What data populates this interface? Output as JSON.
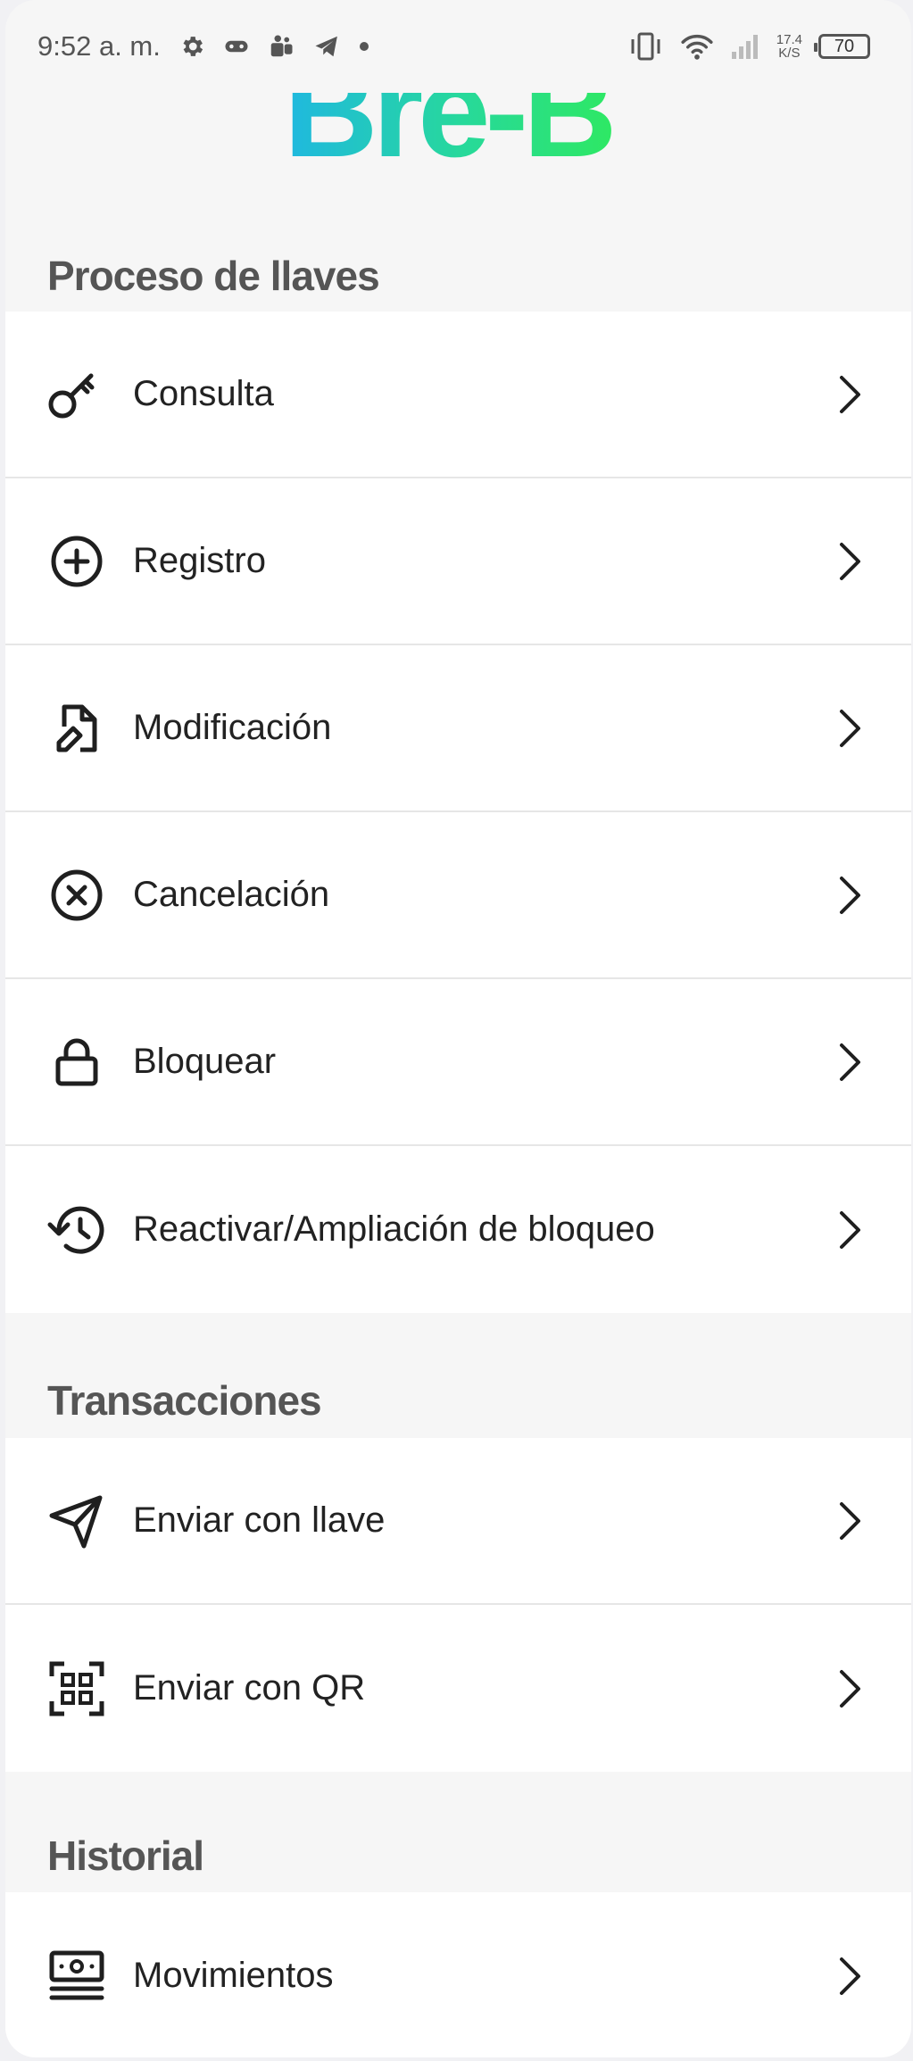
{
  "status_bar": {
    "time": "9:52 a. m.",
    "net_speed_value": "17.4",
    "net_speed_unit": "K/S",
    "battery": "70",
    "left_icons": [
      "gear-icon",
      "gamepad-icon",
      "teams-icon",
      "telegram-icon",
      "dot-icon"
    ],
    "right_icons": [
      "vibrate-icon",
      "wifi-icon",
      "signal-icon",
      "battery-icon"
    ]
  },
  "brand": {
    "logo_text": "Bre-B",
    "gradient": [
      "#1fb8e0",
      "#2ee864"
    ]
  },
  "sections": {
    "keys": {
      "title": "Proceso de llaves",
      "items": [
        {
          "label": "Consulta",
          "icon": "key-icon"
        },
        {
          "label": "Registro",
          "icon": "add-circle-icon"
        },
        {
          "label": "Modificación",
          "icon": "edit-document-icon"
        },
        {
          "label": "Cancelación",
          "icon": "cancel-circle-icon"
        },
        {
          "label": "Bloquear",
          "icon": "lock-icon"
        },
        {
          "label": "Reactivar/Ampliación de bloqueo",
          "icon": "history-icon"
        }
      ]
    },
    "transactions": {
      "title": "Transacciones",
      "items": [
        {
          "label": "Enviar con llave",
          "icon": "send-icon"
        },
        {
          "label": "Enviar con QR",
          "icon": "qr-scan-icon"
        }
      ]
    },
    "history": {
      "title": "Historial",
      "items": [
        {
          "label": "Movimientos",
          "icon": "money-icon"
        }
      ]
    }
  },
  "colors": {
    "background": "#f6f6f6",
    "card": "#ffffff",
    "section_title": "#555555",
    "text": "#222222"
  }
}
